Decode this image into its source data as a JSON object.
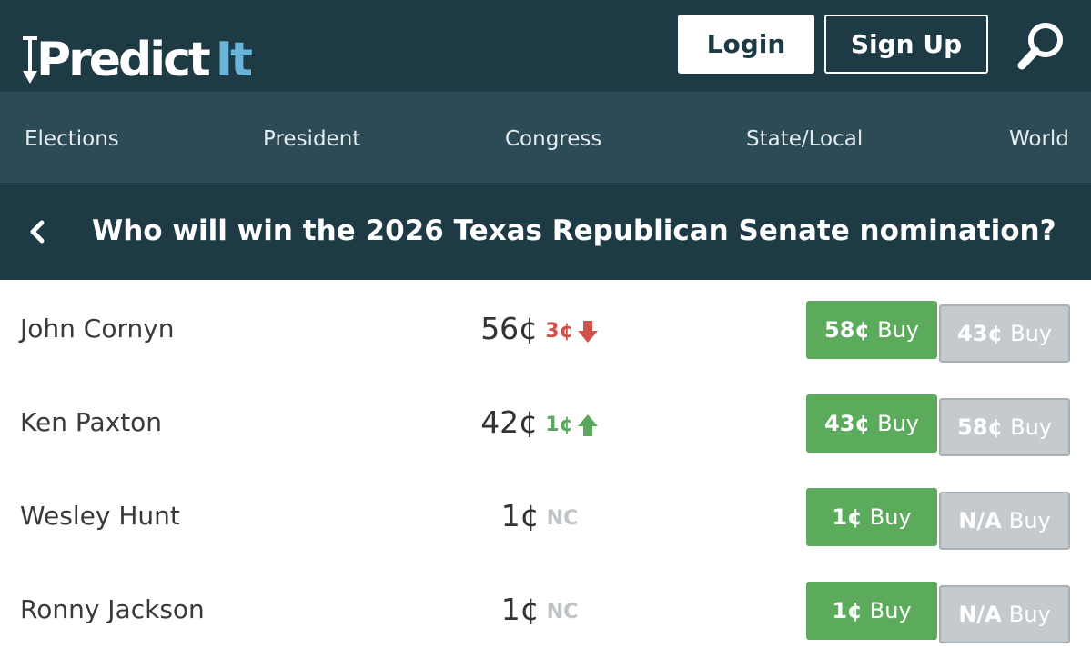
{
  "header": {
    "logo_main": "Predict",
    "logo_accent": "It",
    "login_label": "Login",
    "signup_label": "Sign Up",
    "search_icon": "search-icon"
  },
  "nav": {
    "items": [
      {
        "label": "Elections"
      },
      {
        "label": "President"
      },
      {
        "label": "Congress"
      },
      {
        "label": "State/Local"
      },
      {
        "label": "World"
      }
    ]
  },
  "market": {
    "back_icon": "chevron-left-icon",
    "title": "Who will win the 2026 Texas Republican Senate nomination?"
  },
  "contracts": [
    {
      "name": "John Cornyn",
      "price": "56¢",
      "change": "3¢",
      "direction": "down",
      "yes_amount": "58¢",
      "yes_label": "Buy",
      "no_amount": "43¢",
      "no_label": "Buy"
    },
    {
      "name": "Ken Paxton",
      "price": "42¢",
      "change": "1¢",
      "direction": "up",
      "yes_amount": "43¢",
      "yes_label": "Buy",
      "no_amount": "58¢",
      "no_label": "Buy"
    },
    {
      "name": "Wesley Hunt",
      "price": "1¢",
      "change": "NC",
      "direction": "none",
      "yes_amount": "1¢",
      "yes_label": "Buy",
      "no_amount": "N/A",
      "no_label": "Buy"
    },
    {
      "name": "Ronny Jackson",
      "price": "1¢",
      "change": "NC",
      "direction": "none",
      "yes_amount": "1¢",
      "yes_label": "Buy",
      "no_amount": "N/A",
      "no_label": "Buy"
    }
  ],
  "colors": {
    "header_bg": "#1e3a45",
    "nav_bg": "#2d4b57",
    "buy_yes": "#5cab5c",
    "buy_no": "#c4cacd",
    "change_down": "#d0524d",
    "change_up": "#5aa85d",
    "logo_accent": "#6ab3d9"
  }
}
